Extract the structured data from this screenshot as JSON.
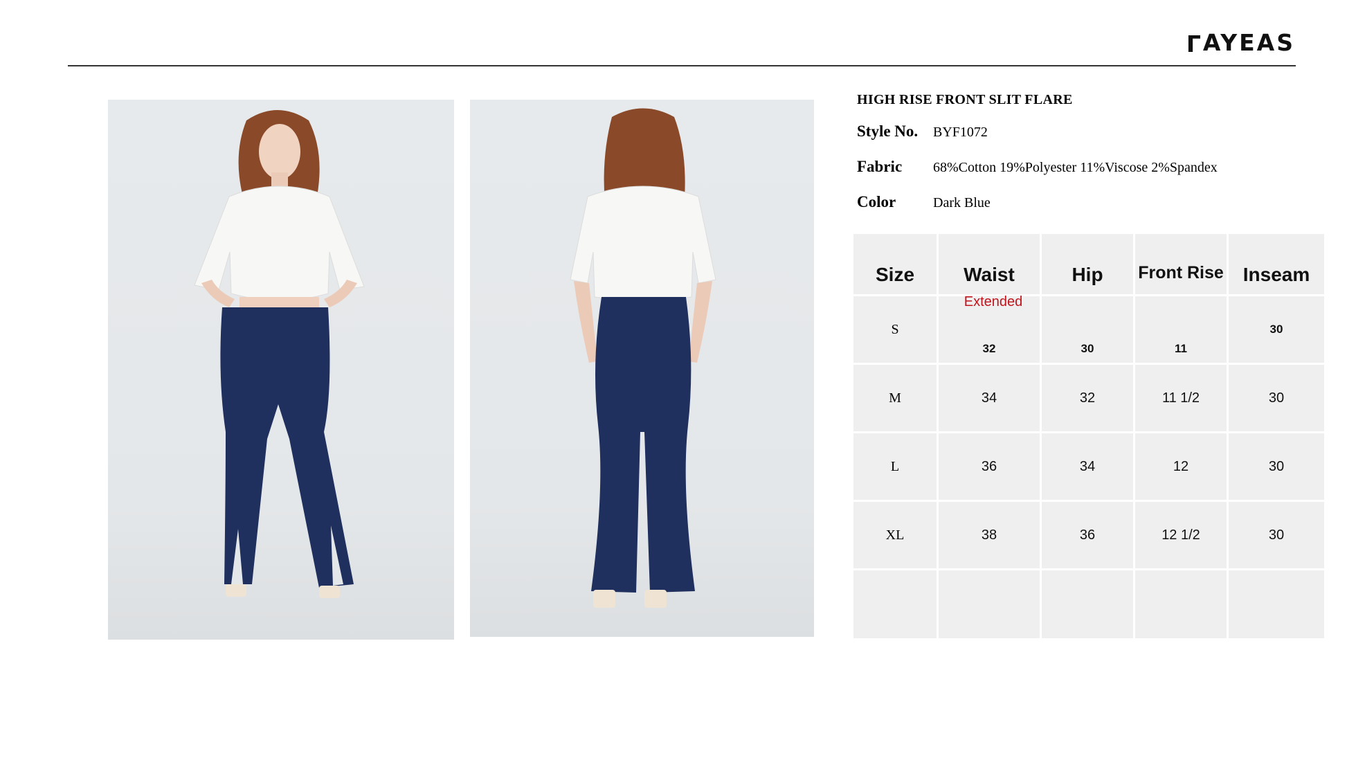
{
  "brand": {
    "name": "AYEAS",
    "mark": "L"
  },
  "product": {
    "title": "HIGH RISE FRONT SLIT FLARE",
    "specs": [
      {
        "label": "Style No.",
        "value": "BYF1072"
      },
      {
        "label": "Fabric",
        "value": "68%Cotton 19%Polyester 11%Viscose 2%Spandex"
      },
      {
        "label": "Color",
        "value": "Dark Blue"
      }
    ]
  },
  "size_table": {
    "headers": [
      "Size",
      "Waist",
      "Hip",
      "Front Rise",
      "Inseam"
    ],
    "note": "Extended",
    "rows": [
      {
        "size": "S",
        "waist": "32",
        "hip": "30",
        "front_rise": "11",
        "inseam": "30"
      },
      {
        "size": "M",
        "waist": "34",
        "hip": "32",
        "front_rise": "11 1/2",
        "inseam": "30"
      },
      {
        "size": "L",
        "waist": "36",
        "hip": "34",
        "front_rise": "12",
        "inseam": "30"
      },
      {
        "size": "XL",
        "waist": "38",
        "hip": "36",
        "front_rise": "12 1/2",
        "inseam": "30"
      },
      {
        "size": "",
        "waist": "",
        "hip": "",
        "front_rise": "",
        "inseam": ""
      }
    ]
  },
  "colors": {
    "denim": "#1f2f5e",
    "shirt": "#f7f7f5",
    "hair": "#8a4a2a",
    "background": "#e6e9eb",
    "table_cell": "#efefef",
    "note_red": "#c0141c"
  }
}
